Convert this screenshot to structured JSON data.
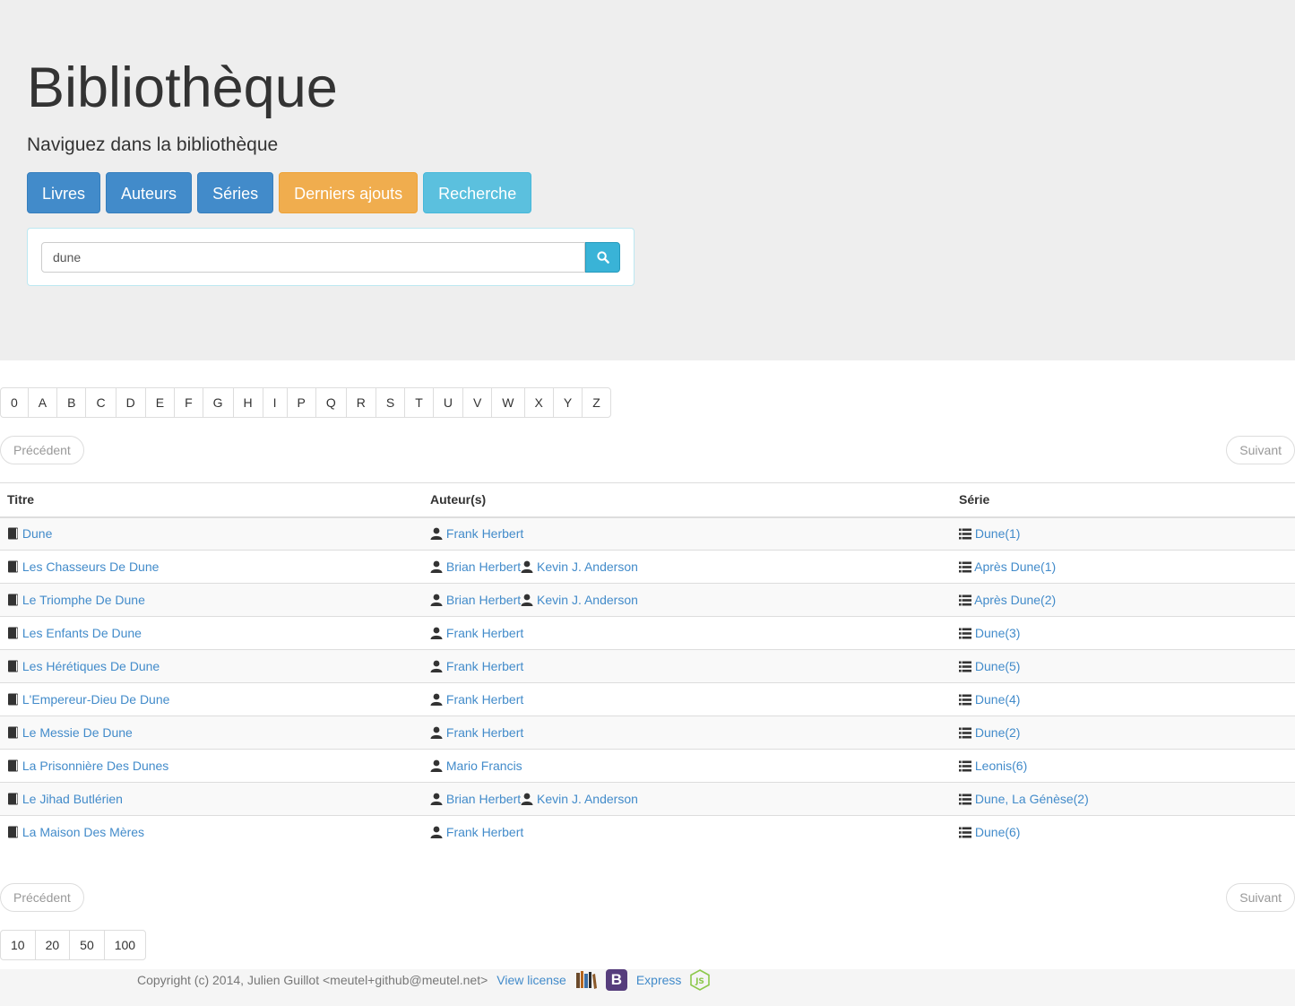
{
  "header": {
    "title": "Bibliothèque",
    "subtitle": "Naviguez dans la bibliothèque"
  },
  "nav": {
    "books": "Livres",
    "authors": "Auteurs",
    "series": "Séries",
    "latest": "Derniers ajouts",
    "search": "Recherche"
  },
  "search": {
    "value": "dune",
    "icon": "search-icon"
  },
  "alphabet": [
    "0",
    "A",
    "B",
    "C",
    "D",
    "E",
    "F",
    "G",
    "H",
    "I",
    "P",
    "Q",
    "R",
    "S",
    "T",
    "U",
    "V",
    "W",
    "X",
    "Y",
    "Z"
  ],
  "pager": {
    "prev": "Précédent",
    "next": "Suivant"
  },
  "table": {
    "headers": {
      "title": "Titre",
      "authors": "Auteur(s)",
      "series": "Série"
    },
    "rows": [
      {
        "title": "Dune",
        "authors": [
          "Frank Herbert"
        ],
        "series": "Dune(1)"
      },
      {
        "title": "Les Chasseurs De Dune",
        "authors": [
          "Brian Herbert",
          "Kevin J. Anderson"
        ],
        "series": "Après Dune(1)"
      },
      {
        "title": "Le Triomphe De Dune",
        "authors": [
          "Brian Herbert",
          "Kevin J. Anderson"
        ],
        "series": "Après Dune(2)"
      },
      {
        "title": "Les Enfants De Dune",
        "authors": [
          "Frank Herbert"
        ],
        "series": "Dune(3)"
      },
      {
        "title": "Les Hérétiques De Dune",
        "authors": [
          "Frank Herbert"
        ],
        "series": "Dune(5)"
      },
      {
        "title": "L'Empereur-Dieu De Dune",
        "authors": [
          "Frank Herbert"
        ],
        "series": "Dune(4)"
      },
      {
        "title": "Le Messie De Dune",
        "authors": [
          "Frank Herbert"
        ],
        "series": "Dune(2)"
      },
      {
        "title": "La Prisonnière Des Dunes",
        "authors": [
          "Mario Francis"
        ],
        "series": "Leonis(6)"
      },
      {
        "title": "Le Jihad Butlérien",
        "authors": [
          "Brian Herbert",
          "Kevin J. Anderson"
        ],
        "series": "Dune, La Génèse(2)"
      },
      {
        "title": "La Maison Des Mères",
        "authors": [
          "Frank Herbert"
        ],
        "series": "Dune(6)"
      }
    ]
  },
  "page_sizes": [
    "10",
    "20",
    "50",
    "100"
  ],
  "footer": {
    "copyright": "Copyright (c) 2014, Julien Guillot <meutel+github@meutel.net>",
    "license": "View license",
    "express": "Express",
    "bootstrap_letter": "B",
    "node_letters": "JS"
  },
  "colors": {
    "primary": "#428bca",
    "warning": "#f0ad4e",
    "info": "#5bc0de",
    "link": "#428bca",
    "bootstrap": "#563d7c",
    "node": "#8cc84b"
  }
}
